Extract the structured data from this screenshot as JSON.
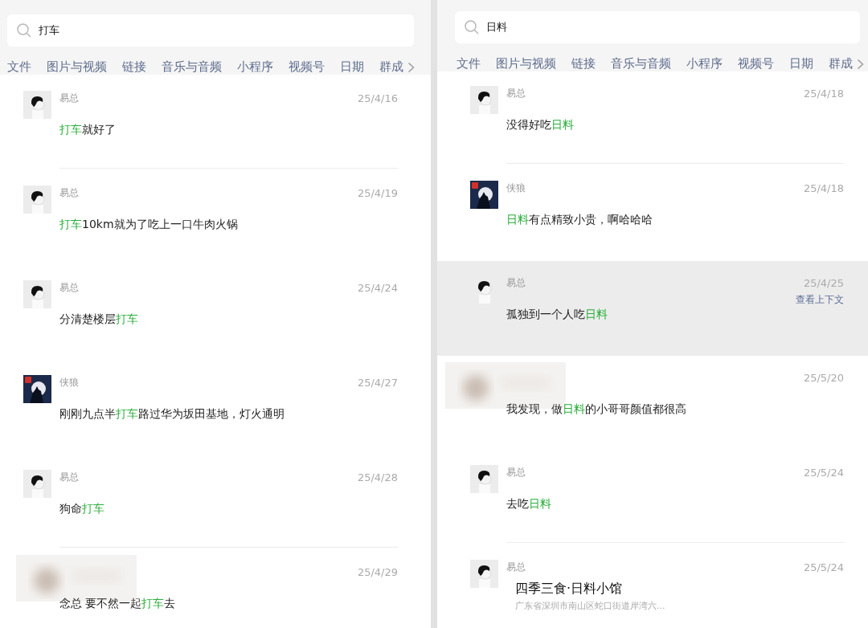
{
  "panels": [
    {
      "search": {
        "value": "打车"
      },
      "tabs": [
        "文件",
        "图片与视频",
        "链接",
        "音乐与音频",
        "小程序",
        "视频号",
        "日期",
        "群成"
      ],
      "results": [
        {
          "kind": "message",
          "avatar": {
            "kind": "person"
          },
          "name": "易总",
          "date": "25/4/16",
          "selected": false,
          "divider": true,
          "message": [
            {
              "text": "打车",
              "match": true
            },
            {
              "text": "就好了",
              "match": false
            }
          ]
        },
        {
          "kind": "message",
          "avatar": {
            "kind": "person"
          },
          "name": "易总",
          "date": "25/4/19",
          "selected": false,
          "divider": false,
          "message": [
            {
              "text": "打车",
              "match": true
            },
            {
              "text": "10km就为了吃上一口牛肉火锅",
              "match": false
            }
          ]
        },
        {
          "kind": "message",
          "avatar": {
            "kind": "person"
          },
          "name": "易总",
          "date": "25/4/24",
          "selected": false,
          "divider": false,
          "message": [
            {
              "text": "分清楚楼层",
              "match": false
            },
            {
              "text": "打车",
              "match": true
            }
          ]
        },
        {
          "kind": "message",
          "avatar": {
            "kind": "wolf"
          },
          "name": "侠狼",
          "date": "25/4/27",
          "selected": false,
          "divider": false,
          "message": [
            {
              "text": "刚刚九点半",
              "match": false
            },
            {
              "text": "打车",
              "match": true
            },
            {
              "text": "路过华为坂田基地，灯火通明",
              "match": false
            }
          ]
        },
        {
          "kind": "message",
          "avatar": {
            "kind": "person"
          },
          "name": "易总",
          "date": "25/4/28",
          "selected": false,
          "divider": true,
          "message": [
            {
              "text": "狗命",
              "match": false
            },
            {
              "text": "打车",
              "match": true
            }
          ]
        },
        {
          "kind": "message",
          "avatar": {
            "kind": "blurred"
          },
          "date": "25/4/29",
          "selected": false,
          "divider": false,
          "message": [
            {
              "text": "念总 要不然一起",
              "match": false
            },
            {
              "text": "打车",
              "match": true
            },
            {
              "text": "去",
              "match": false
            }
          ]
        }
      ]
    },
    {
      "search": {
        "value": "日料"
      },
      "tabs": [
        "文件",
        "图片与视频",
        "链接",
        "音乐与音频",
        "小程序",
        "视频号",
        "日期",
        "群成"
      ],
      "results": [
        {
          "kind": "message",
          "avatar": {
            "kind": "person"
          },
          "name": "易总",
          "date": "25/4/18",
          "selected": false,
          "divider": true,
          "message": [
            {
              "text": "没得好吃",
              "match": false
            },
            {
              "text": "日料",
              "match": true
            }
          ]
        },
        {
          "kind": "message",
          "avatar": {
            "kind": "wolf"
          },
          "name": "侠狼",
          "date": "25/4/18",
          "selected": false,
          "divider": false,
          "message": [
            {
              "text": "日料",
              "match": true
            },
            {
              "text": "有点精致小贵，啊哈哈哈",
              "match": false
            }
          ]
        },
        {
          "kind": "message",
          "avatar": {
            "kind": "person"
          },
          "name": "易总",
          "date": "25/4/25",
          "selected": true,
          "divider": false,
          "context_link": "查看上下文",
          "message": [
            {
              "text": "孤独到一个人吃",
              "match": false
            },
            {
              "text": "日料",
              "match": true
            }
          ]
        },
        {
          "kind": "message",
          "avatar": {
            "kind": "blurred"
          },
          "date": "25/5/20",
          "selected": false,
          "divider": false,
          "message": [
            {
              "text": "我发现，做",
              "match": false
            },
            {
              "text": "日料",
              "match": true
            },
            {
              "text": "的小哥哥颜值都很高",
              "match": false
            }
          ]
        },
        {
          "kind": "message",
          "avatar": {
            "kind": "person"
          },
          "name": "易总",
          "date": "25/5/24",
          "selected": false,
          "divider": true,
          "message": [
            {
              "text": "去吃",
              "match": false
            },
            {
              "text": "日料",
              "match": true
            }
          ]
        },
        {
          "kind": "location",
          "avatar": {
            "kind": "person"
          },
          "name": "易总",
          "date": "25/5/24",
          "selected": false,
          "divider": false,
          "place": {
            "title": "四季三食·日料小馆",
            "address": "广东省深圳市南山区蛇口街道岸湾六..."
          }
        }
      ]
    }
  ]
}
